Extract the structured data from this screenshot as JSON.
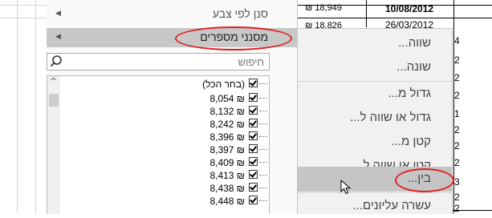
{
  "sheet": {
    "partial_cells": [
      {
        "col": "amount",
        "text": "₪ 18,949"
      },
      {
        "col": "date",
        "text": "10/08/2012"
      },
      {
        "col": "amount",
        "text": "₪ 18,826"
      },
      {
        "col": "date",
        "text": "26/03/2012"
      }
    ],
    "edge_digits": [
      "4",
      "2",
      "2",
      "2",
      "1",
      "2",
      "2",
      "2",
      "3",
      "2",
      "2"
    ]
  },
  "filter_panel": {
    "sort_by_color": "סנן לפי צבע",
    "number_filters": "מסנני מספרים",
    "search_placeholder": "חיפוש",
    "items": [
      {
        "label": "(בחר הכל)",
        "checked": true
      },
      {
        "label": "8,054 ₪",
        "checked": true
      },
      {
        "label": "8,132 ₪",
        "checked": true
      },
      {
        "label": "8,242 ₪",
        "checked": true
      },
      {
        "label": "8,396 ₪",
        "checked": true
      },
      {
        "label": "8,397 ₪",
        "checked": true
      },
      {
        "label": "8,409 ₪",
        "checked": true
      },
      {
        "label": "8,413 ₪",
        "checked": true
      },
      {
        "label": "8,438 ₪",
        "checked": true
      },
      {
        "label": "8,448 ₪",
        "checked": true
      }
    ]
  },
  "number_filter_menu": {
    "items": [
      {
        "label": "שווה...",
        "highlighted": false
      },
      {
        "label": "שונה...",
        "highlighted": false
      },
      {
        "label": "גדול מ...",
        "highlighted": false
      },
      {
        "label": "גדול או שווה ל...",
        "highlighted": false
      },
      {
        "label": "קטן מ...",
        "highlighted": false
      },
      {
        "label": "קטן או שווה ל...",
        "highlighted": false
      },
      {
        "label": "בין...",
        "highlighted": true
      },
      {
        "label": "עשרה עליונים...",
        "highlighted": false
      }
    ]
  },
  "annotations": {
    "highlight_color": "#e02020"
  }
}
